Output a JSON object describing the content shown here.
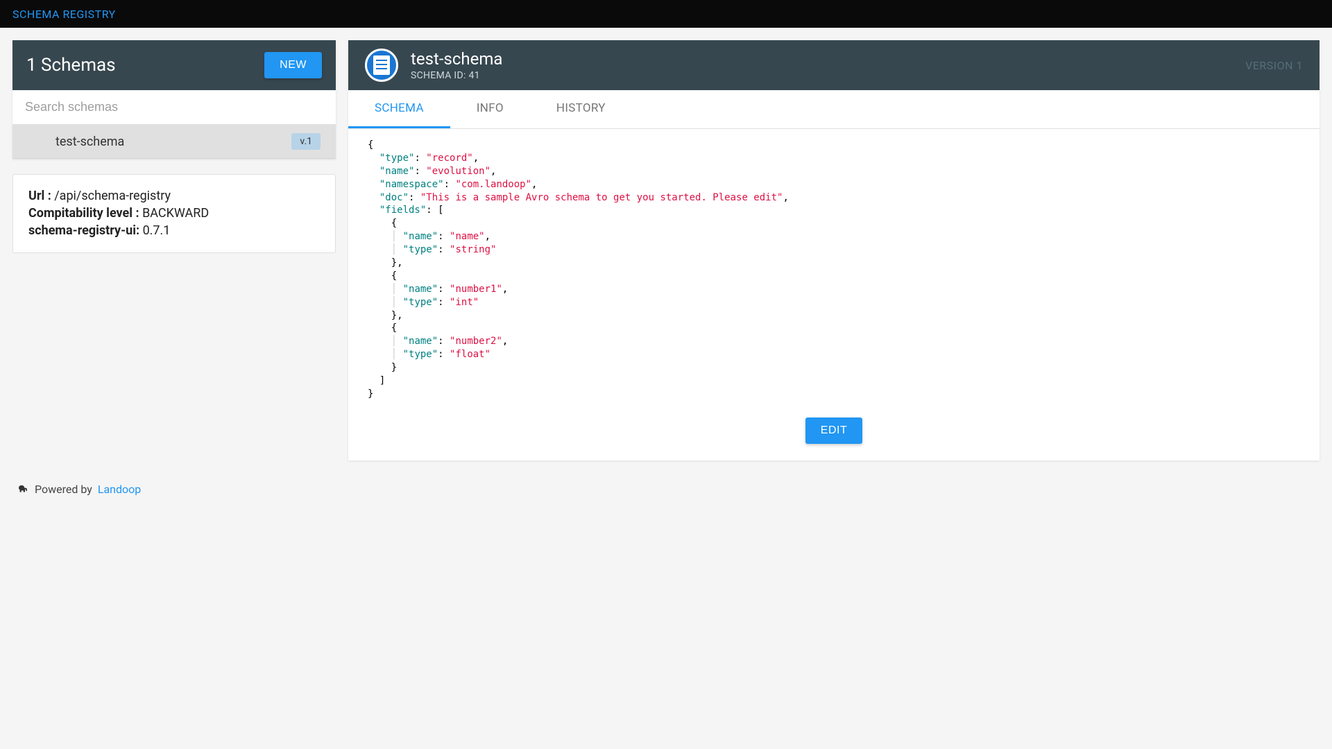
{
  "topbar": {
    "title": "SCHEMA REGISTRY"
  },
  "left": {
    "header_title": "1 Schemas",
    "new_button": "NEW",
    "search_placeholder": "Search schemas",
    "items": [
      {
        "name": "test-schema",
        "version_badge": "v.1"
      }
    ],
    "info": {
      "url_label": "Url :",
      "url_value": "/api/schema-registry",
      "compat_label": "Compitability level :",
      "compat_value": "BACKWARD",
      "ui_label": "schema-registry-ui:",
      "ui_value": "0.7.1"
    }
  },
  "right": {
    "title": "test-schema",
    "subtitle": "SCHEMA ID: 41",
    "version_label": "VERSION 1",
    "tabs": {
      "schema": "SCHEMA",
      "info": "INFO",
      "history": "HISTORY"
    },
    "edit_button": "EDIT",
    "schema_json": {
      "type": "record",
      "name": "evolution",
      "namespace": "com.landoop",
      "doc": "This is a sample Avro schema to get you started. Please edit",
      "fields": [
        {
          "name": "name",
          "type": "string"
        },
        {
          "name": "number1",
          "type": "int"
        },
        {
          "name": "number2",
          "type": "float"
        }
      ]
    }
  },
  "footer": {
    "powered_by": "Powered by",
    "link_text": "Landoop"
  }
}
